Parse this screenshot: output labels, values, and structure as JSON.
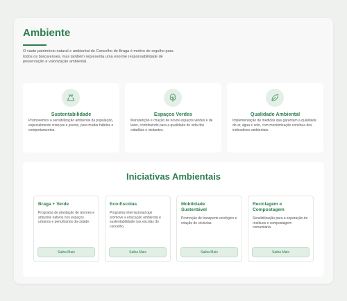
{
  "header": {
    "title": "Ambiente",
    "intro": "O vasto património natural e ambiental do Concelho de Braga é motivo de orgulho para todos os bracarenses, mas também representa uma enorme responsabilidade de preservação e valorização ambiental."
  },
  "features": [
    {
      "icon": "recycle-icon",
      "title": "Sustentabilidade",
      "text": "Promovemos a sensibilização ambiental da população, especialmente crianças e jovens, para mudar hábitos e comportamentos."
    },
    {
      "icon": "tree-icon",
      "title": "Espaços Verdes",
      "text": "Manutenção e criação de novos espaços verdes e de lazer, contribuindo para a qualidade de vida dos cidadãos e visitantes."
    },
    {
      "icon": "leaf-icon",
      "title": "Qualidade Ambiental",
      "text": "Implementação de medidas que garantam a qualidade do ar, água e solo, com monitorização contínua dos indicadores ambientais."
    }
  ],
  "initiatives": {
    "title": "Iniciativas Ambientais",
    "button_label": "Saiba Mais",
    "items": [
      {
        "title": "Braga + Verde",
        "text": "Programa de plantação de árvores e arbustos nativos nos espaços urbanos e periurbanos da cidade."
      },
      {
        "title": "Eco-Escolas",
        "text": "Programa internacional que promove a educação ambiental e sustentabilidade nas escolas do concelho."
      },
      {
        "title": "Mobilidade Sustentável",
        "text": "Promoção de transporte ecológico e criação de ciclovias."
      },
      {
        "title": "Reciclagem e Compostagem",
        "text": "Sensibilização para a separação de resíduos e compostagem comunitária."
      }
    ]
  },
  "colors": {
    "accent": "#2e7d4f",
    "icon_bg": "#e4efe7",
    "button_bg": "#e1efe5"
  }
}
